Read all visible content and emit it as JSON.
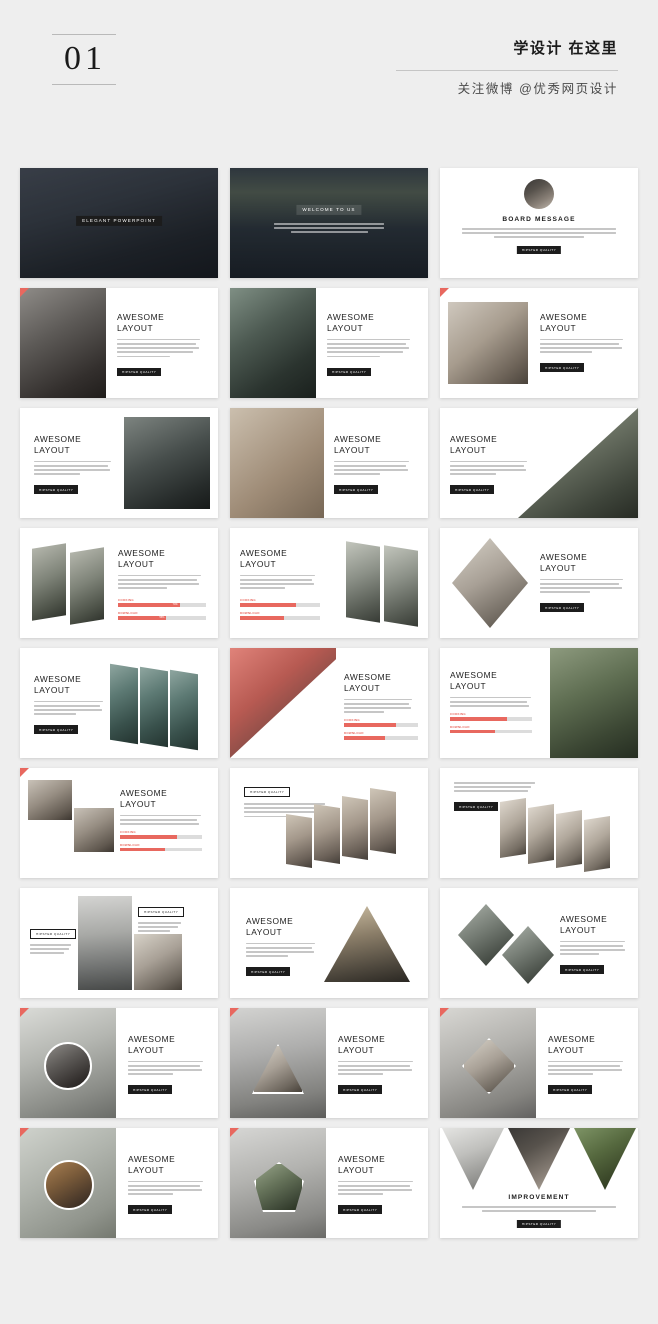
{
  "header": {
    "number": "01",
    "cn_title": "学设计 在这里",
    "cn_subtitle": "关注微博 @优秀网页设计"
  },
  "labels": {
    "awesome_layout": "AWESOME\nLAYOUT",
    "badge_hipster": "HIPSTER QUALITY",
    "elegant_powerpoint": "ELEGANT POWERPOINT",
    "welcome": "WELCOME TO US",
    "board_message": "BOARD MESSAGE",
    "improvement": "IMPROVEMENT",
    "bar_label_1": "COOKING",
    "bar_label_2": "DOWNLOAD",
    "bar_pct_1": "70%",
    "bar_pct_2": "55%"
  },
  "colors": {
    "background": "#eeeeee",
    "slide": "#ffffff",
    "accent_red": "#e8685f",
    "dark": "#1c1c1c",
    "text": "#1d1d1d"
  },
  "slides": [
    {
      "n": 1,
      "name": "elegant-powerpoint-cover"
    },
    {
      "n": 2,
      "name": "welcome-to-us-cover"
    },
    {
      "n": 3,
      "name": "board-message"
    },
    {
      "n": 4,
      "name": "awesome-layout-mug"
    },
    {
      "n": 5,
      "name": "awesome-layout-camera"
    },
    {
      "n": 6,
      "name": "awesome-layout-watch"
    },
    {
      "n": 7,
      "name": "awesome-layout-man-right"
    },
    {
      "n": 8,
      "name": "awesome-layout-wheel"
    },
    {
      "n": 9,
      "name": "awesome-layout-forest"
    },
    {
      "n": 10,
      "name": "awesome-layout-path-bars"
    },
    {
      "n": 11,
      "name": "awesome-layout-tower-bars"
    },
    {
      "n": 12,
      "name": "awesome-layout-girl-diamond"
    },
    {
      "n": 13,
      "name": "awesome-layout-car-slices"
    },
    {
      "n": 14,
      "name": "awesome-layout-redcar-diagonal"
    },
    {
      "n": 15,
      "name": "awesome-layout-desk-bars"
    },
    {
      "n": 16,
      "name": "awesome-layout-couple-grid"
    },
    {
      "n": 17,
      "name": "awesome-layout-photog-slices"
    },
    {
      "n": 18,
      "name": "awesome-layout-hands-slices"
    },
    {
      "n": 19,
      "name": "awesome-layout-waterfall-grid"
    },
    {
      "n": 20,
      "name": "awesome-layout-triangle-center"
    },
    {
      "n": 21,
      "name": "awesome-layout-diamond-pair"
    },
    {
      "n": 22,
      "name": "awesome-layout-pine-mug"
    },
    {
      "n": 23,
      "name": "awesome-layout-mountain-triangle"
    },
    {
      "n": 24,
      "name": "awesome-layout-bike-diamond"
    },
    {
      "n": 25,
      "name": "awesome-layout-bear-circle"
    },
    {
      "n": 26,
      "name": "awesome-layout-castle-pentagon"
    },
    {
      "n": 27,
      "name": "improvement-triangles"
    }
  ]
}
